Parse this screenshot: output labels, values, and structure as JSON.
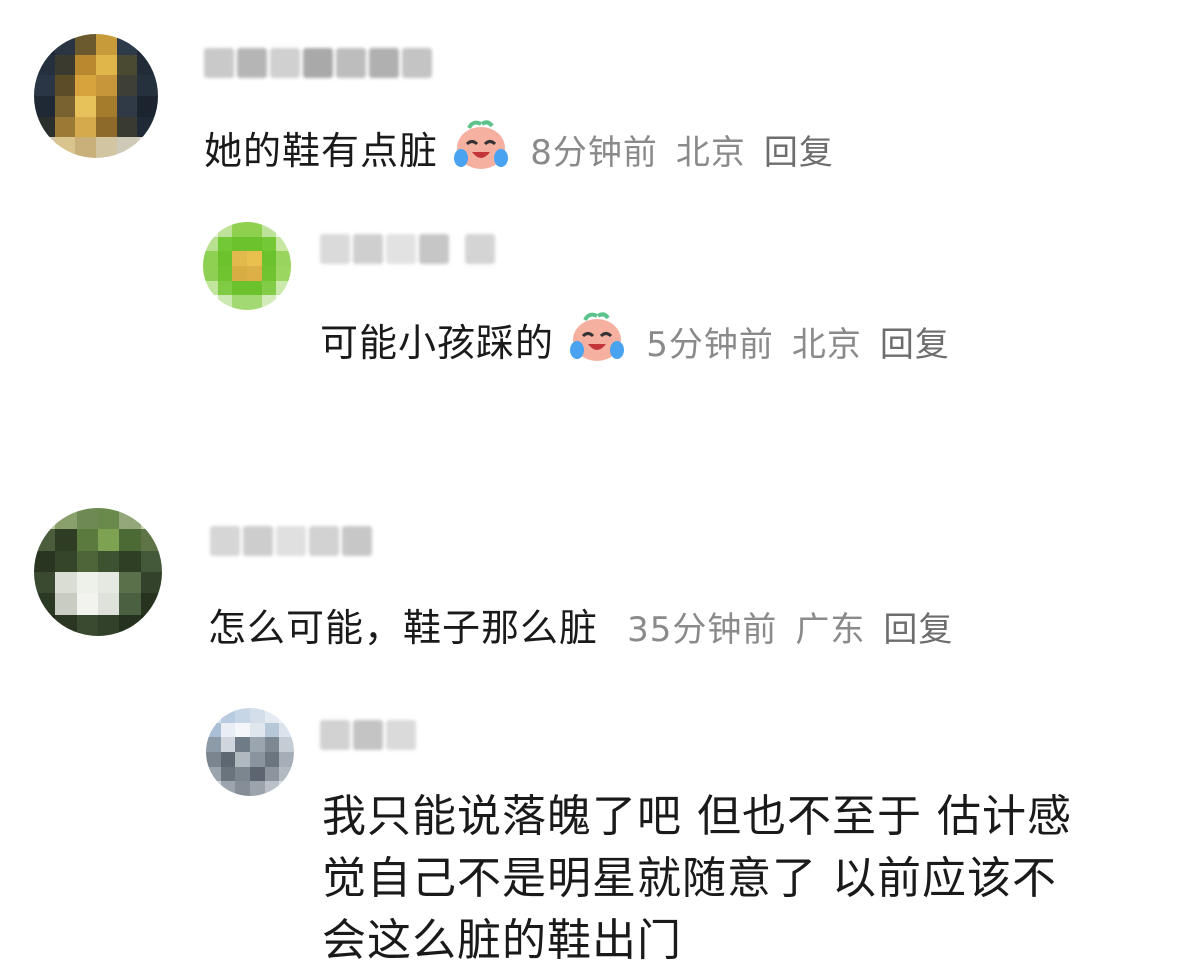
{
  "comments": [
    {
      "text": "她的鞋有点脏",
      "time": "8分钟前",
      "location": "北京",
      "reply": "回复",
      "emoji": "crying-laughing-emoji",
      "username_blurred": true
    },
    {
      "text": "可能小孩踩的",
      "time": "5分钟前",
      "location": "北京",
      "reply": "回复",
      "emoji": "crying-laughing-emoji",
      "username_blurred": true
    },
    {
      "text": "怎么可能，鞋子那么脏",
      "time": "35分钟前",
      "location": "广东",
      "reply": "回复",
      "username_blurred": true
    },
    {
      "lines": [
        "我只能说落魄了吧 但也不至于 估计感",
        "觉自己不是明星就随意了 以前应该不",
        "会这么脏的鞋出门"
      ],
      "username_blurred": true
    }
  ],
  "colors": {
    "text": "#1a1a1a",
    "meta": "#8a8a8a",
    "background": "#ffffff"
  }
}
